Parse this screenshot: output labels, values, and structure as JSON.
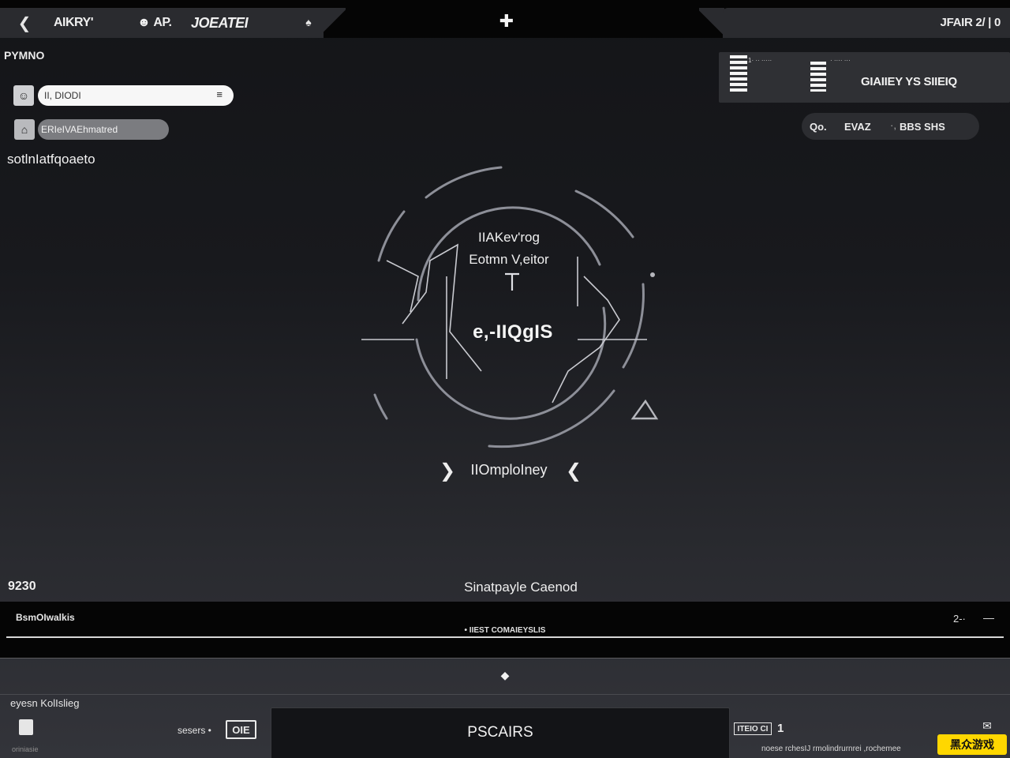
{
  "topbar": {
    "back_icon": "chevron-left-icon",
    "nav_1": "AIKRY'",
    "nav_2": "AP.",
    "nav_3": "JOEATEI",
    "bell_icon": "bell-icon",
    "plus_icon": "plus-icon",
    "right_label": "JFAIR 2/ | 0"
  },
  "left_panel": {
    "profile_label": "PYMNO",
    "search_value": "II, DIODI",
    "search_icon": "menu-icon",
    "status_pill": "ERIeIVAEhmatred",
    "sub_label": "sotlnIatfqoaeto"
  },
  "right_panel": {
    "card_tiny_1": "1· ·· ·····",
    "card_tiny_2": "· ···· ···",
    "card_title": "GIAIIEY YS SIIEIQ",
    "stats": [
      "Qo.",
      "EVAZ",
      "·,",
      "BBS SHS"
    ]
  },
  "center": {
    "title_line_1": "IIAKev'rog",
    "title_line_2": "Eotmn V,eitor",
    "value": "e,-IIQgIS",
    "mode_label": "IIOmploIney",
    "prev_icon": "chevron-right-icon",
    "next_icon": "chevron-left-icon"
  },
  "lower_strip": {
    "score_left": "9230",
    "status_center": "Sinatpayle Caenod",
    "bar_left_label": "BsmOIwalkis",
    "bar_center_label": "• IIEST COMAIEYSLIS",
    "bar_right_1": "2-·",
    "bar_right_2": "—"
  },
  "bottom_panel": {
    "left_title": "eyesn KolIslieg",
    "left_tiny": "oriniasie",
    "left_value_label": "sesers •",
    "left_value_box": "OIE",
    "center_label": "PSCAIRS",
    "right_box": "ITEIO CI",
    "right_count": "1",
    "right_tiny": "noese rchesIJ rmolindrurnrei ,rochemee",
    "watermark": "黑众游戏"
  },
  "colors": {
    "background": "#18191d",
    "bar": "#050505",
    "panel": "#2a2b2f",
    "text": "#e6e6e6",
    "watermark": "#ffd700"
  }
}
